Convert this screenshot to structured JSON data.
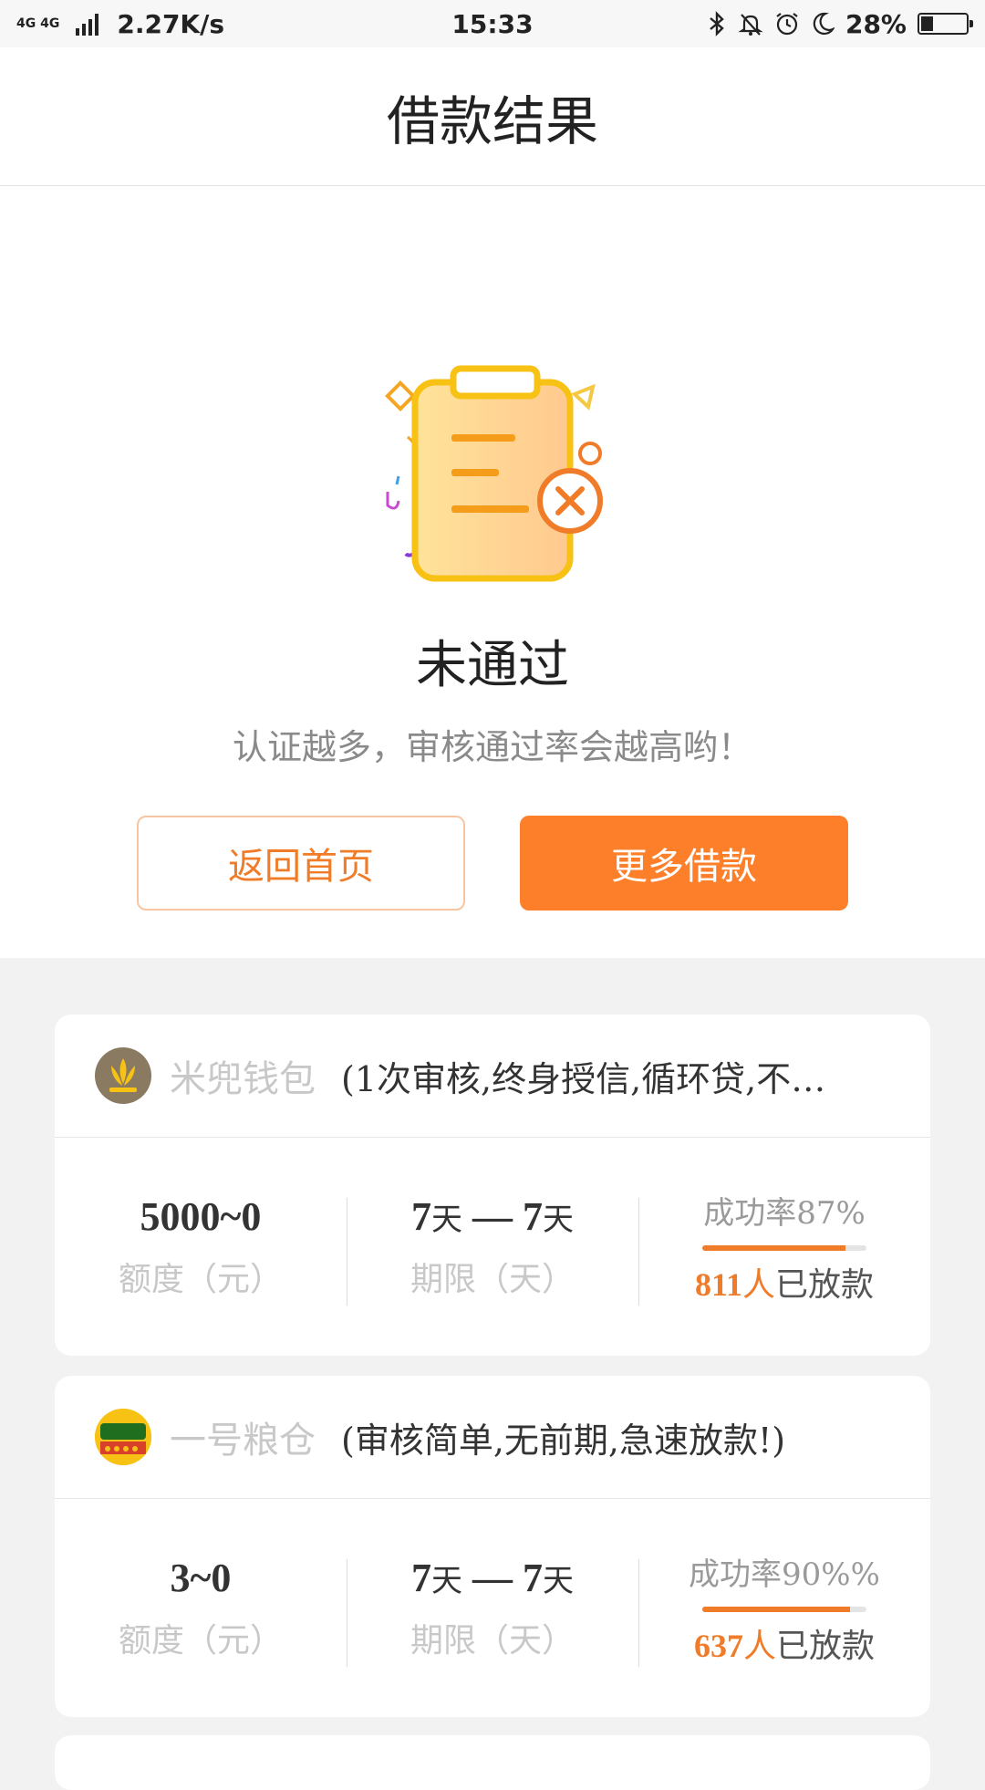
{
  "status_bar": {
    "network_top": "4G 4G",
    "speed": "2.27K/s",
    "time": "15:33",
    "battery": "28%",
    "battery_level": 0.28,
    "icons": [
      "bluetooth-icon",
      "bell-off-icon",
      "alarm-icon",
      "moon-icon",
      "battery-icon"
    ]
  },
  "header": {
    "title": "借款结果"
  },
  "result": {
    "icon": "rejected-clipboard-icon",
    "title": "未通过",
    "subtitle": "认证越多，审核通过率会越高哟！",
    "btn_home": "返回首页",
    "btn_more": "更多借款"
  },
  "colors": {
    "accent": "#fd7f2a",
    "accent_text": "#f07c2a",
    "muted": "#c8c8c8"
  },
  "lenders": [
    {
      "name": "米兜钱包",
      "promo": "(1次审核,终身授信,循环贷,不…",
      "amount": "5000~0",
      "amount_label": "额度（元）",
      "term_from": "7",
      "term_to": "7",
      "term_unit": "天",
      "term_sep": " — ",
      "term_label": "期限（天）",
      "success_rate": "成功率87%",
      "success_fraction": 0.87,
      "loaned_count": "811",
      "loaned_ren": "人",
      "loaned_suffix": "已放款"
    },
    {
      "name": "一号粮仓",
      "promo": "(审核简单,无前期,急速放款!)",
      "amount": "3~0",
      "amount_label": "额度（元）",
      "term_from": "7",
      "term_to": "7",
      "term_unit": "天",
      "term_sep": " — ",
      "term_label": "期限（天）",
      "success_rate": "成功率90%%",
      "success_fraction": 0.9,
      "loaned_count": "637",
      "loaned_ren": "人",
      "loaned_suffix": "已放款"
    }
  ]
}
